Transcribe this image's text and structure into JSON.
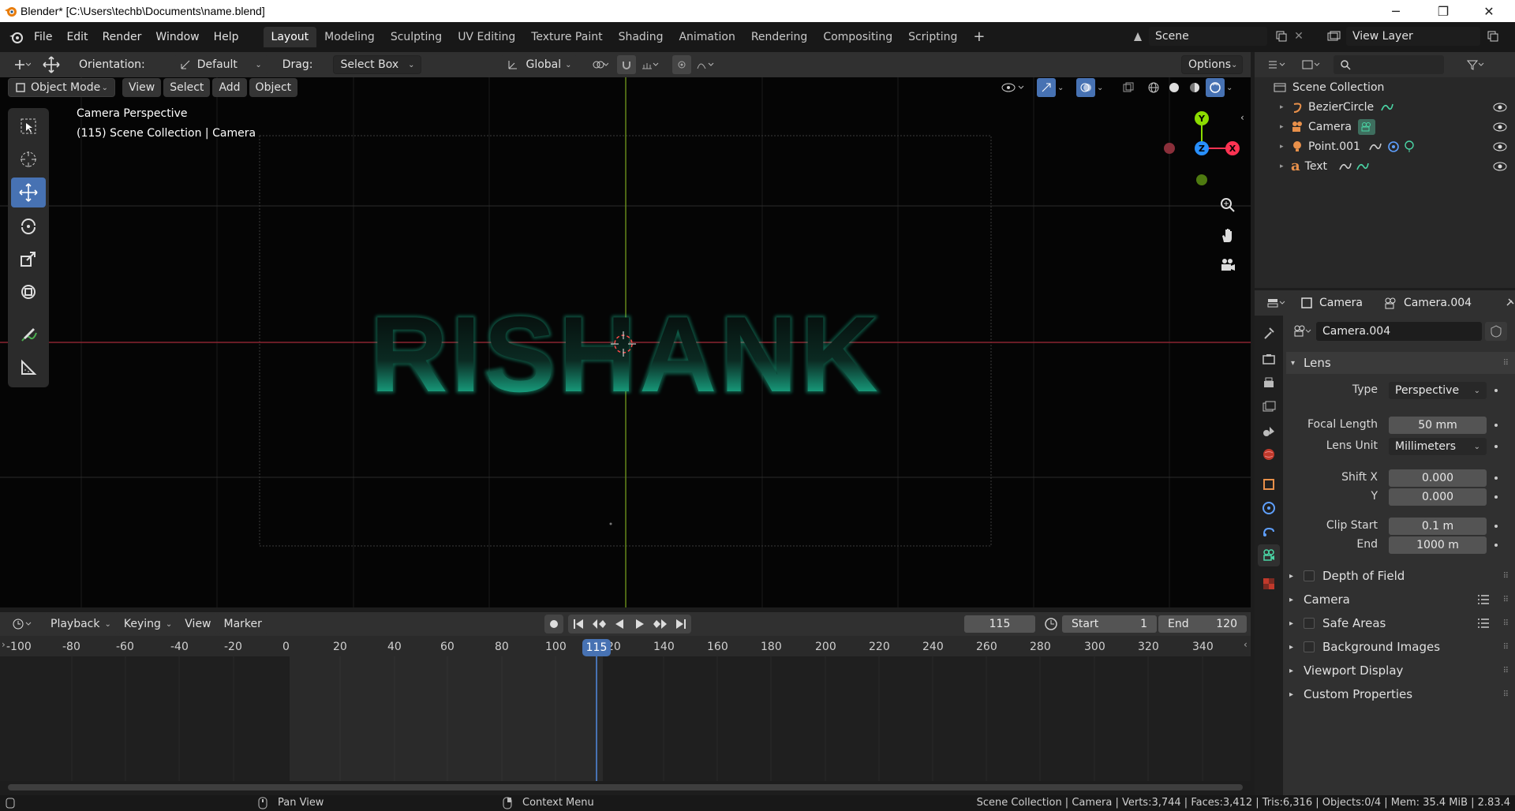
{
  "window": {
    "title": "Blender* [C:\\Users\\techb\\Documents\\name.blend]",
    "minimize": "─",
    "maximize": "❐",
    "close": "✕"
  },
  "menu": [
    "File",
    "Edit",
    "Render",
    "Window",
    "Help"
  ],
  "workspaces": [
    "Layout",
    "Modeling",
    "Sculpting",
    "UV Editing",
    "Texture Paint",
    "Shading",
    "Animation",
    "Rendering",
    "Compositing",
    "Scripting"
  ],
  "active_workspace": "Layout",
  "add_workspace": "+",
  "scene": {
    "value": "Scene"
  },
  "view_layer": {
    "value": "View Layer"
  },
  "header": {
    "orientation_label": "Orientation:",
    "orientation_value": "Default",
    "drag_label": "Drag:",
    "drag_value": "Select Box",
    "transform_space": "Global",
    "options": "Options"
  },
  "viewport_header": {
    "mode": "Object Mode",
    "view": "View",
    "select": "Select",
    "add": "Add",
    "object": "Object"
  },
  "viewport": {
    "info_line1": "Camera Perspective",
    "info_line2": "(115) Scene Collection | Camera",
    "scene_text": "RISHANK",
    "gizmo_x": "X",
    "gizmo_y": "Y",
    "gizmo_z": "Z"
  },
  "outliner": {
    "root": "Scene Collection",
    "items": [
      {
        "name": "BezierCircle"
      },
      {
        "name": "Camera"
      },
      {
        "name": "Point.001"
      },
      {
        "name": "Text"
      }
    ]
  },
  "properties": {
    "breadcrumb_object": "Camera",
    "breadcrumb_data": "Camera.004",
    "datablock": "Camera.004",
    "lens_panel": "Lens",
    "type_label": "Type",
    "type_value": "Perspective",
    "focal_label": "Focal Length",
    "focal_value": "50 mm",
    "lens_unit_label": "Lens Unit",
    "lens_unit_value": "Millimeters",
    "shift_x_label": "Shift X",
    "shift_x_value": "0.000",
    "shift_y_label": "Y",
    "shift_y_value": "0.000",
    "clip_start_label": "Clip Start",
    "clip_start_value": "0.1 m",
    "clip_end_label": "End",
    "clip_end_value": "1000 m",
    "panels": [
      "Depth of Field",
      "Camera",
      "Safe Areas",
      "Background Images",
      "Viewport Display",
      "Custom Properties"
    ]
  },
  "timeline": {
    "playback": "Playback",
    "keying": "Keying",
    "view": "View",
    "marker": "Marker",
    "current_frame": "115",
    "start_label": "Start",
    "start_value": "1",
    "end_label": "End",
    "end_value": "120",
    "ticks": [
      "-100",
      "-80",
      "-60",
      "-40",
      "-20",
      "0",
      "20",
      "40",
      "60",
      "80",
      "100",
      "20",
      "140",
      "160",
      "180",
      "200",
      "220",
      "240",
      "260",
      "280",
      "300",
      "320",
      "340"
    ],
    "playhead_label": "115"
  },
  "status": {
    "pan_view": "Pan View",
    "context_menu": "Context Menu",
    "stats": "Scene Collection | Camera | Verts:3,744 | Faces:3,412 | Tris:6,316 | Objects:0/4 | Mem: 35.4 MiB | 2.83.4"
  },
  "colors": {
    "accent": "#4772b3",
    "x_axis": "#ff3352",
    "y_axis": "#8bdc00",
    "z_axis": "#2890ff",
    "text_glow": "#1fe0b0"
  }
}
